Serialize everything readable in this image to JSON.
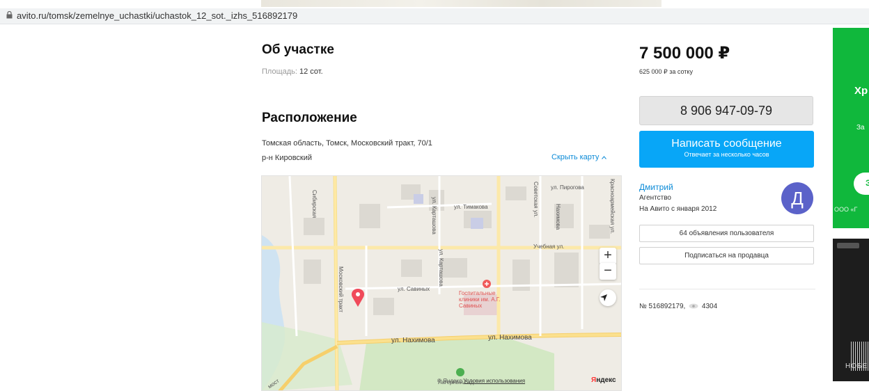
{
  "browser": {
    "url": "avito.ru/tomsk/zemelnye_uchastki/uchastok_12_sot._izhs_516892179"
  },
  "about": {
    "title": "Об участке",
    "area_label": "Площадь:",
    "area_value": "12 сот."
  },
  "location": {
    "title": "Расположение",
    "address": "Томская область, Томск, Московский тракт, 70/1",
    "district": "р-н Кировский",
    "hide_map": "Скрыть карту",
    "hide_map_chevron": "chevron-up-icon"
  },
  "map": {
    "labels": {
      "sibirskaya": "Сибирская",
      "kartashova": "ул. Карташова",
      "timakova": "ул. Тимакова",
      "sovetskaya": "Советская ул.",
      "pirogova": "ул. Пирогова",
      "krasnoarmeyskaya": "Красноармейская ул.",
      "nakhimova_top": "Нахимова",
      "uchebnaya": "Учебная ул.",
      "kartashova2": "ул. Карташова",
      "savinykh": "ул. Савиных",
      "moskovsky": "Московский тракт",
      "nakhimova1": "ул. Нахимова",
      "nakhimova2": "ул. Нахимова",
      "hospital": "Госпитальные клиники им. А.Г. Савиных",
      "park": "Лагерный сад",
      "most": "мост",
      "zoom_in": "+",
      "zoom_out": "−"
    },
    "copyright": "© Яндекс",
    "terms": "Условия использования",
    "brand_y": "Я",
    "brand_rest": "ндекс"
  },
  "price": {
    "value": "7 500 000 ₽",
    "per_unit": "625 000 ₽ за сотку"
  },
  "contact": {
    "phone": "8 906 947-09-79",
    "message_btn": "Написать сообщение",
    "message_sub": "Отвечает за несколько часов"
  },
  "seller": {
    "name": "Дмитрий",
    "type": "Агентство",
    "since": "На Авито с января 2012",
    "avatar_letter": "Д",
    "listings_btn": "64 объявления пользователя",
    "subscribe_btn": "Подписаться на продавца"
  },
  "meta": {
    "listing_no": "№ 516892179,",
    "views": "4304",
    "views_icon": "eye-icon"
  },
  "ads": {
    "green_line1": "Хр",
    "green_line2": "За",
    "green_btn": "З",
    "green_footer": "ООО «Г",
    "dark_brand": "НОБЕ"
  },
  "colors": {
    "accent": "#08a6f7",
    "link": "#0a8ad7",
    "avatar": "#5b62c9",
    "marker": "#f04a5a",
    "ad_green": "#10b83c"
  }
}
